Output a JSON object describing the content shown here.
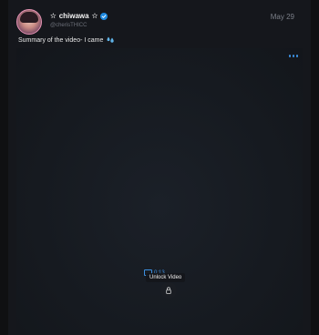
{
  "post": {
    "author": {
      "name": "chiwawa",
      "handle": "@cherisTHICC",
      "decor_left": "✫",
      "decor_right": "✫"
    },
    "date": "May 29",
    "caption": "Summary of the video- I came",
    "caption_emoji": "sweat-droplets-icon",
    "media": {
      "duration": "0:13",
      "unlock_label": "Unlock Video",
      "icons": [
        "video-icon",
        "lock-icon",
        "more-icon"
      ]
    }
  },
  "colors": {
    "background": "#0f1012",
    "card": "#15171c",
    "accent": "#3c8fe0",
    "verified": "#1f8ae0",
    "avatar_border": "#e493b3"
  }
}
